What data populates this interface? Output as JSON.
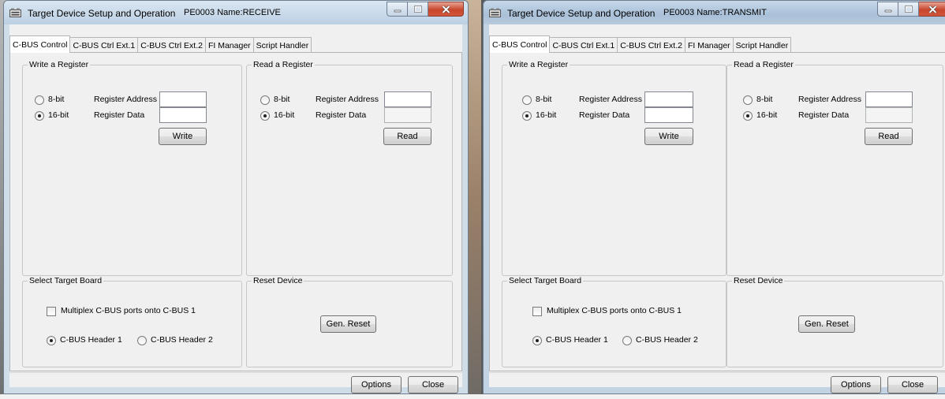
{
  "windows": [
    {
      "title": "Target Device Setup and Operation",
      "device_name": "PE0003 Name:RECEIVE",
      "tabs": [
        "C-BUS Control",
        "C-BUS Ctrl Ext.1",
        "C-BUS Ctrl Ext.2",
        "FI Manager",
        "Script Handler"
      ],
      "write_group": {
        "title": "Write a Register",
        "radio_8bit": "8-bit",
        "radio_16bit": "16-bit",
        "selected": "16-bit",
        "address_label": "Register Address",
        "data_label": "Register Data",
        "address_value": "",
        "data_value": "",
        "button": "Write"
      },
      "read_group": {
        "title": "Read a Register",
        "radio_8bit": "8-bit",
        "radio_16bit": "16-bit",
        "selected": "16-bit",
        "address_label": "Register Address",
        "data_label": "Register Data",
        "address_value": "",
        "data_value": "",
        "button": "Read"
      },
      "target_group": {
        "title": "Select Target Board",
        "multiplex_label": "Multiplex C-BUS ports onto C-BUS 1",
        "multiplex_checked": false,
        "header1": "C-BUS Header 1",
        "header2": "C-BUS Header 2",
        "selected": "C-BUS Header 1"
      },
      "reset_group": {
        "title": "Reset Device",
        "button": "Gen. Reset"
      },
      "footer": {
        "options": "Options",
        "close": "Close"
      }
    },
    {
      "title": "Target Device Setup and Operation",
      "device_name": "PE0003 Name:TRANSMIT",
      "tabs": [
        "C-BUS Control",
        "C-BUS Ctrl Ext.1",
        "C-BUS Ctrl Ext.2",
        "FI Manager",
        "Script Handler"
      ],
      "write_group": {
        "title": "Write a Register",
        "radio_8bit": "8-bit",
        "radio_16bit": "16-bit",
        "selected": "16-bit",
        "address_label": "Register Address",
        "data_label": "Register Data",
        "address_value": "",
        "data_value": "",
        "button": "Write"
      },
      "read_group": {
        "title": "Read a Register",
        "radio_8bit": "8-bit",
        "radio_16bit": "16-bit",
        "selected": "16-bit",
        "address_label": "Register Address",
        "data_label": "Register Data",
        "address_value": "",
        "data_value": "",
        "button": "Read"
      },
      "target_group": {
        "title": "Select Target Board",
        "multiplex_label": "Multiplex C-BUS ports onto C-BUS 1",
        "multiplex_checked": false,
        "header1": "C-BUS Header 1",
        "header2": "C-BUS Header 2",
        "selected": "C-BUS Header 1"
      },
      "reset_group": {
        "title": "Reset Device",
        "button": "Gen. Reset"
      },
      "footer": {
        "options": "Options",
        "close": "Close"
      }
    }
  ],
  "colors": {
    "close_button": "#c9462d",
    "titlebar": "#bcd0e3",
    "dialog_face": "#f0f0f0"
  }
}
